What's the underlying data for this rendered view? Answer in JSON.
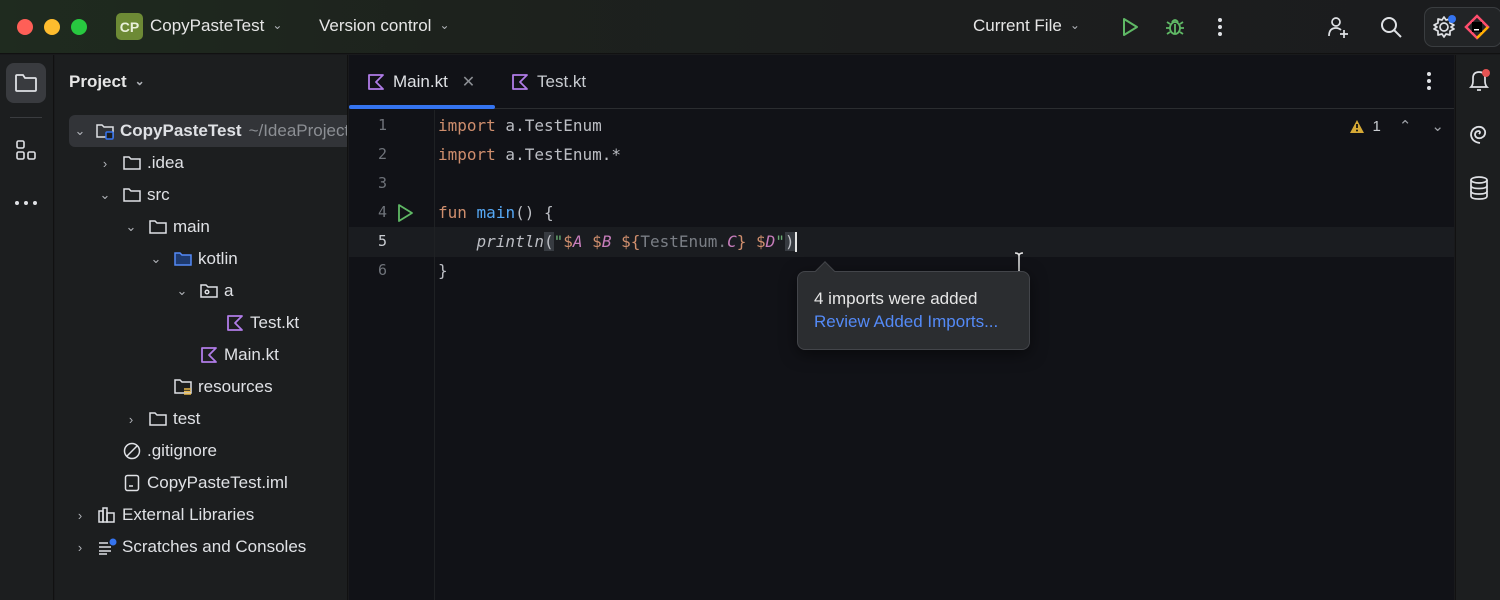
{
  "titlebar": {
    "project_badge": "CP",
    "project_name": "CopyPasteTest",
    "vcs_label": "Version control",
    "run_config": "Current File"
  },
  "toolstrip_left": {
    "items": [
      "project",
      "structure",
      "more"
    ]
  },
  "project_panel": {
    "title": "Project",
    "tree": [
      {
        "label": "CopyPasteTest",
        "hint": "~/IdeaProjects/CopyPasteTest",
        "icon": "module-folder",
        "expanded": true,
        "level": 0,
        "selected": true
      },
      {
        "label": ".idea",
        "icon": "folder",
        "expanded": false,
        "level": 1
      },
      {
        "label": "src",
        "icon": "folder",
        "expanded": true,
        "level": 1
      },
      {
        "label": "main",
        "icon": "folder",
        "expanded": true,
        "level": 2
      },
      {
        "label": "kotlin",
        "icon": "source-folder",
        "expanded": true,
        "level": 3
      },
      {
        "label": "a",
        "icon": "package",
        "expanded": true,
        "level": 4
      },
      {
        "label": "Test.kt",
        "icon": "kotlin-file",
        "level": 5
      },
      {
        "label": "Main.kt",
        "icon": "kotlin-file",
        "level": 4
      },
      {
        "label": "resources",
        "icon": "resources-folder",
        "level": 3
      },
      {
        "label": "test",
        "icon": "folder",
        "expanded": false,
        "level": 2
      },
      {
        "label": ".gitignore",
        "icon": "ignore-file",
        "level": 1
      },
      {
        "label": "CopyPasteTest.iml",
        "icon": "iml-file",
        "level": 1
      },
      {
        "label": "External Libraries",
        "icon": "libraries",
        "expanded": false,
        "level": 0
      },
      {
        "label": "Scratches and Consoles",
        "icon": "scratches",
        "expanded": false,
        "level": 0
      }
    ]
  },
  "editor": {
    "tabs": [
      {
        "label": "Main.kt",
        "active": true,
        "closable": true
      },
      {
        "label": "Test.kt",
        "active": false
      }
    ],
    "inspection": {
      "warnings": "1"
    },
    "current_line": 5,
    "lines": [
      {
        "num": "1",
        "text": "import a.TestEnum"
      },
      {
        "num": "2",
        "text": "import a.TestEnum.*"
      },
      {
        "num": "3",
        "text": ""
      },
      {
        "num": "4",
        "text": "fun main() {"
      },
      {
        "num": "5",
        "text": "    println(\"$A $B ${TestEnum.C} $D\")"
      },
      {
        "num": "6",
        "text": "}"
      }
    ],
    "tokens": {
      "import": "import",
      "l1_rest": " a.TestEnum",
      "l2_rest": " a.TestEnum.*",
      "fun": "fun",
      "main": "main",
      "l4_rest": "() {",
      "indent": "    ",
      "println": "println",
      "open_paren": "(",
      "quote": "\"",
      "dA": "$",
      "A": "A",
      "sp": " ",
      "dB": "$",
      "B": "B",
      "dlb": "${",
      "TestEnum": "TestEnum.",
      "C": "C",
      "rb": "}",
      "dD": "$",
      "D": "D",
      "close_paren": ")",
      "close_brace": "}"
    }
  },
  "popup": {
    "message": "4 imports were added",
    "link": "Review Added Imports..."
  },
  "toolstrip_right": {
    "items": [
      "notifications",
      "ai-assistant",
      "database"
    ]
  },
  "colors": {
    "accent": "#3574f0",
    "keyword": "#cf8e6d",
    "function": "#56a8f5",
    "string": "#6aab73",
    "property": "#c77dbb",
    "link": "#548af7",
    "run": "#5fb865"
  }
}
